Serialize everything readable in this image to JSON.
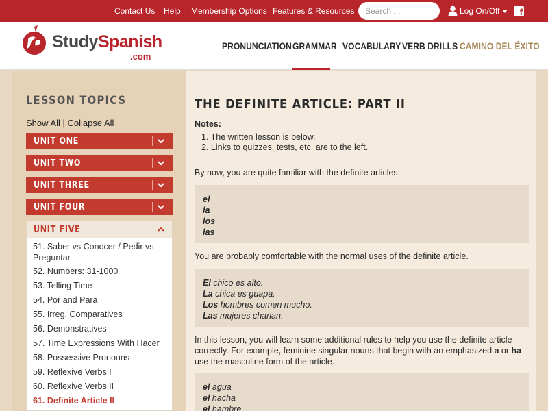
{
  "topbar": {
    "links": [
      "Contact Us",
      "Help",
      "Membership Options",
      "Features & Resources"
    ],
    "search_placeholder": "Search ...",
    "login_label": "Log On/Off"
  },
  "header": {
    "logo_study": "Study",
    "logo_spanish": "Spanish",
    "logo_com": ".com",
    "nav": [
      "PRONUNCIATION",
      "GRAMMAR",
      "VOCABULARY",
      "VERB DRILLS",
      "CAMINO DEL ÉXITO"
    ],
    "active_nav": "GRAMMAR"
  },
  "sidebar": {
    "title": "LESSON TOPICS",
    "show_all": "Show All",
    "separator": " | ",
    "collapse_all": "Collapse All",
    "units": [
      "UNIT ONE",
      "UNIT TWO",
      "UNIT THREE",
      "UNIT FOUR",
      "UNIT FIVE"
    ],
    "lessons": [
      "51. Saber vs Conocer / Pedir vs Preguntar",
      "52. Numbers: 31-1000",
      "53. Telling Time",
      "54. Por and Para",
      "55. Irreg. Comparatives",
      "56. Demonstratives",
      "57. Time Expressions With Hacer",
      "58. Possessive Pronouns",
      "59. Reflexive Verbs I",
      "60. Reflexive Verbs II",
      "61. Definite Article II"
    ],
    "active_lesson": "61. Definite Article II"
  },
  "main": {
    "title": "THE DEFINITE ARTICLE: PART II",
    "notes_label": "Notes:",
    "notes": [
      "1. The written lesson is below.",
      "2. Links to quizzes, tests, etc. are to the left."
    ],
    "p1": "By now, you are quite familiar with the definite articles:",
    "articles": [
      "el",
      "la",
      "los",
      "las"
    ],
    "p2": "You are probably comfortable with the normal uses of the definite article.",
    "examples": [
      {
        "article": "El",
        "rest": " chico es alto."
      },
      {
        "article": "La",
        "rest": " chica es guapa."
      },
      {
        "article": "Los",
        "rest": " hombres comen mucho."
      },
      {
        "article": "Las",
        "rest": " mujeres charlan."
      }
    ],
    "p3_a": "In this lesson, you will learn some additional rules to help you use the definite article correctly. For example, feminine singular nouns that begin with an emphasized ",
    "p3_bold1": "a",
    "p3_b": " or ",
    "p3_bold2": "ha",
    "p3_c": " use the masculine form of the article.",
    "examples2": [
      {
        "article": "el",
        "rest": " agua"
      },
      {
        "article": "el",
        "rest": " hacha"
      },
      {
        "article": "el",
        "rest": " hambre"
      }
    ]
  },
  "colors": {
    "brand_red": "#b8262b",
    "unit_red": "#c33a2e",
    "gold": "#a88a58"
  }
}
